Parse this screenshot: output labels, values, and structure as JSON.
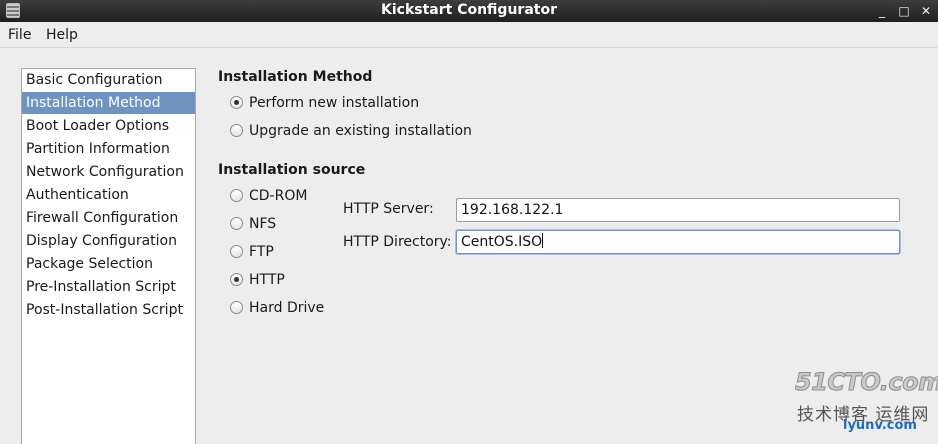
{
  "window": {
    "title": "Kickstart Configurator",
    "controls": [
      "_",
      "□",
      "✕"
    ]
  },
  "menu": {
    "items": [
      "File",
      "Help"
    ]
  },
  "sidebar": {
    "selected_index": 1,
    "items": [
      "Basic Configuration",
      "Installation Method",
      "Boot Loader Options",
      "Partition Information",
      "Network Configuration",
      "Authentication",
      "Firewall Configuration",
      "Display Configuration",
      "Package Selection",
      "Pre-Installation Script",
      "Post-Installation Script"
    ]
  },
  "installation_method": {
    "heading": "Installation Method",
    "options": [
      {
        "label": "Perform new installation",
        "checked": true
      },
      {
        "label": "Upgrade an existing installation",
        "checked": false
      }
    ]
  },
  "installation_source": {
    "heading": "Installation source",
    "options": [
      {
        "label": "CD-ROM",
        "checked": false
      },
      {
        "label": "NFS",
        "checked": false
      },
      {
        "label": "FTP",
        "checked": false
      },
      {
        "label": "HTTP",
        "checked": true
      },
      {
        "label": "Hard Drive",
        "checked": false
      }
    ],
    "http_server": {
      "label": "HTTP Server:",
      "value": "192.168.122.1"
    },
    "http_directory": {
      "label": "HTTP Directory:",
      "value": "CentOS.ISO"
    }
  },
  "watermark": {
    "line1": "51CTO.com",
    "line2": "技术博客  运维网",
    "line3": "iyunv.com"
  },
  "colors": {
    "selection": "#6f94c1",
    "titlebar": "#2b2b2b"
  }
}
